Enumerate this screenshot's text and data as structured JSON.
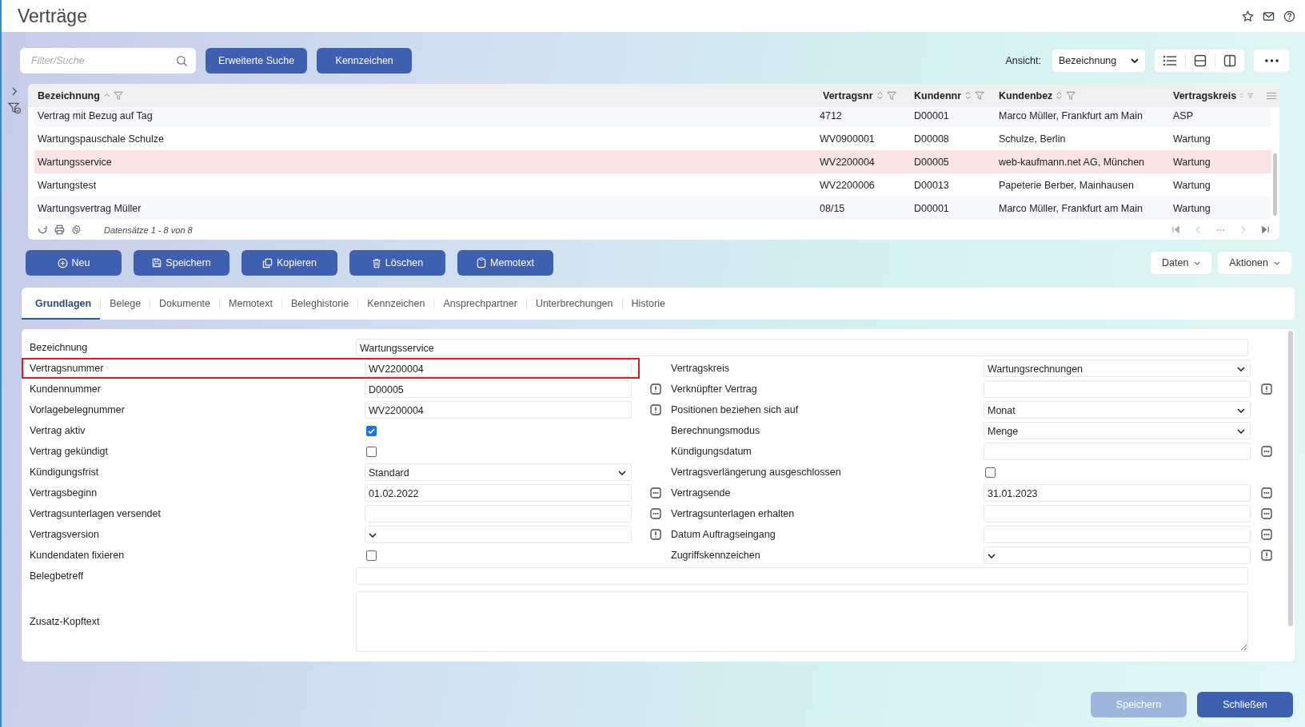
{
  "window": {
    "title": "Verträge"
  },
  "toolbar": {
    "search": {
      "placeholder": "Filter/Suche"
    },
    "buttons": [
      "Erweiterte Suche",
      "Kennzeichen"
    ],
    "view": {
      "label": "Ansicht:",
      "value": "Bezeichnung"
    }
  },
  "table": {
    "columns": [
      {
        "label": "Bezeichnung",
        "sorted": true
      },
      {
        "label": "Vertragsnr",
        "sorted": false
      },
      {
        "label": "Kundennr",
        "sorted": false
      },
      {
        "label": "Kundenbez",
        "sorted": false
      },
      {
        "label": "Vertragskreis",
        "sorted": false
      }
    ],
    "rows": [
      {
        "cells": [
          "Vertrag mit Bezug auf Tag",
          "4712",
          "D00001",
          "Marco Müller, Frankfurt am Main",
          "ASP"
        ],
        "selected": false
      },
      {
        "cells": [
          "Wartungspauschale Schulze",
          "WV0900001",
          "D00008",
          "Schulze, Berlin",
          "Wartung"
        ],
        "selected": false
      },
      {
        "cells": [
          "Wartungsservice",
          "WV2200004",
          "D00005",
          "web-kaufmann.net AG, München",
          "Wartung"
        ],
        "selected": true
      },
      {
        "cells": [
          "Wartungstest",
          "WV2200006",
          "D00013",
          "Papeterie Berber, Mainhausen",
          "Wartung"
        ],
        "selected": false
      },
      {
        "cells": [
          "Wartungsvertrag Müller",
          "08/15",
          "D00001",
          "Marco Müller, Frankfurt am Main",
          "Wartung"
        ],
        "selected": false
      }
    ],
    "footer": "Datensätze 1 - 8 von 8"
  },
  "actions": [
    {
      "label": "Neu",
      "kind": "new"
    },
    {
      "label": "Speichern",
      "kind": "save"
    },
    {
      "label": "Kopieren",
      "kind": "copy"
    },
    {
      "label": "Löschen",
      "kind": "delete"
    },
    {
      "label": "Memotext",
      "kind": "memo"
    }
  ],
  "menus": [
    "Daten",
    "Aktionen"
  ],
  "tabs": [
    {
      "label": "Grundlagen",
      "selected": true
    },
    {
      "label": "Belege",
      "selected": false
    },
    {
      "label": "Dokumente",
      "selected": false
    },
    {
      "label": "Memotext",
      "selected": false
    },
    {
      "label": "Beleghistorie",
      "selected": false
    },
    {
      "label": "Kennzeichen",
      "selected": false
    },
    {
      "label": "Ansprechpartner",
      "selected": false
    },
    {
      "label": "Unterbrechungen",
      "selected": false
    },
    {
      "label": "Historie",
      "selected": false
    }
  ],
  "form": {
    "rows": [
      {
        "kind": "full",
        "field": {
          "label": "Bezeichnung",
          "kind": "text",
          "value": "Wartungsservice"
        }
      },
      {
        "kind": "pair",
        "left": {
          "label": "Vertragsnummer",
          "kind": "text",
          "value": "WV2200004",
          "highlighted": true
        },
        "right": {
          "label": "Vertragskreis",
          "kind": "select",
          "value": "Wartungsrechnungen"
        }
      },
      {
        "kind": "pair",
        "left": {
          "label": "Kundennummer",
          "kind": "text",
          "value": "D00005",
          "addon": {
            "kind": "info"
          }
        },
        "right": {
          "label": "Verknüpfter Vertrag",
          "kind": "text",
          "addon": {
            "kind": "info"
          }
        }
      },
      {
        "kind": "pair",
        "left": {
          "label": "Vorlagebelegnummer",
          "kind": "text",
          "value": "WV2200004",
          "addon": {
            "kind": "info"
          }
        },
        "right": {
          "label": "Positionen beziehen sich auf",
          "kind": "select",
          "value": "Monat"
        }
      },
      {
        "kind": "pair",
        "left": {
          "label": "Vertrag aktiv",
          "kind": "checkbox",
          "checked": true
        },
        "right": {
          "label": "Berechnungsmodus",
          "kind": "select",
          "value": "Menge"
        }
      },
      {
        "kind": "pair",
        "left": {
          "label": "Vertrag gekündigt",
          "kind": "checkbox",
          "checked": false
        },
        "right": {
          "label": "Kündigungsdatum",
          "kind": "text",
          "addon": {
            "kind": "more"
          }
        }
      },
      {
        "kind": "pair",
        "left": {
          "label": "Kündigungsfrist",
          "kind": "select",
          "value": "Standard"
        },
        "right": {
          "label": "Vertragsverlängerung ausgeschlossen",
          "kind": "checkbox",
          "checked": false
        }
      },
      {
        "kind": "pair",
        "left": {
          "label": "Vertragsbeginn",
          "kind": "text",
          "value": "01.02.2022",
          "addon": {
            "kind": "more"
          }
        },
        "right": {
          "label": "Vertragsende",
          "kind": "text",
          "value": "31.01.2023",
          "addon": {
            "kind": "more"
          }
        }
      },
      {
        "kind": "pair",
        "left": {
          "label": "Vertragsunterlagen versendet",
          "kind": "text",
          "addon": {
            "kind": "more"
          }
        },
        "right": {
          "label": "Vertragsunterlagen erhalten",
          "kind": "text",
          "addon": {
            "kind": "more"
          }
        }
      },
      {
        "kind": "pair",
        "left": {
          "label": "Vertragsversion",
          "kind": "select",
          "addon": {
            "kind": "info"
          }
        },
        "right": {
          "label": "Datum Auftragseingang",
          "kind": "text",
          "addon": {
            "kind": "more"
          }
        }
      },
      {
        "kind": "pair",
        "left": {
          "label": "Kundendaten fixieren",
          "kind": "checkbox",
          "checked": false
        },
        "right": {
          "label": "Zugriffskennzeichen",
          "kind": "select",
          "addon": {
            "kind": "info"
          }
        }
      },
      {
        "kind": "full",
        "field": {
          "label": "Belegbetreff",
          "kind": "text"
        }
      },
      {
        "kind": "full",
        "field": {
          "label": "Zusatz-Kopftext",
          "kind": "textarea"
        }
      }
    ]
  },
  "footer_buttons": [
    {
      "label": "Speichern",
      "disabled": true
    },
    {
      "label": "Schließen",
      "disabled": false
    }
  ]
}
